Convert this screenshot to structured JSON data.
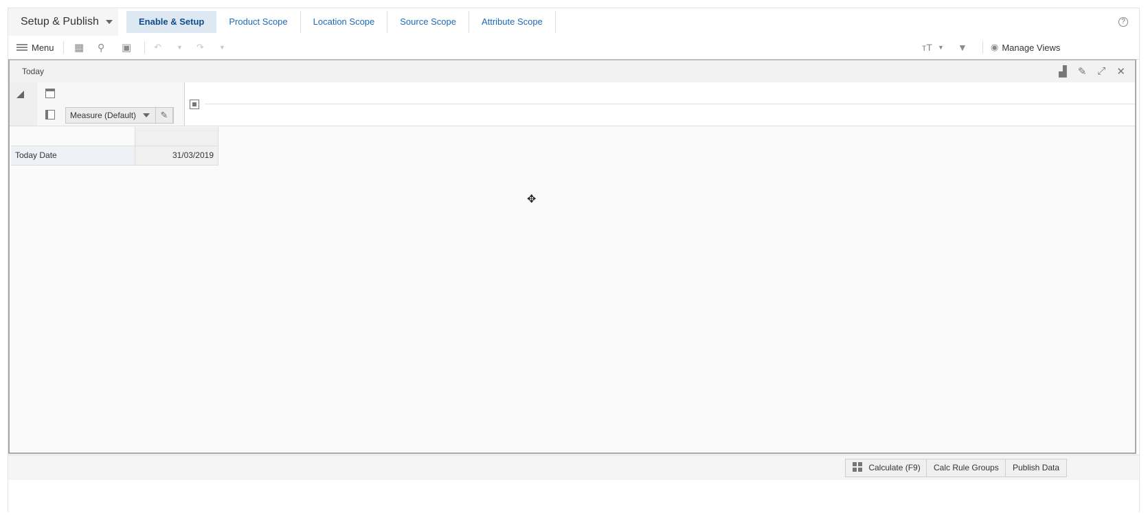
{
  "workspace": {
    "title": "Setup & Publish"
  },
  "tabs": [
    {
      "label": "Enable & Setup",
      "active": true
    },
    {
      "label": "Product Scope"
    },
    {
      "label": "Location Scope"
    },
    {
      "label": "Source Scope"
    },
    {
      "label": "Attribute Scope"
    }
  ],
  "toolbar": {
    "menu_label": "Menu",
    "manage_views_label": "Manage Views"
  },
  "view": {
    "title": "Today",
    "measure_selector": "Measure (Default)",
    "rows": [
      {
        "label": "Today Date",
        "value": "31/03/2019"
      }
    ]
  },
  "footer": {
    "calculate_label": "Calculate (F9)",
    "calc_rule_groups_label": "Calc Rule Groups",
    "publish_label": "Publish Data"
  },
  "colors": {
    "accent": "#1a6ab8",
    "active_tab_bg": "#dde8f3"
  }
}
